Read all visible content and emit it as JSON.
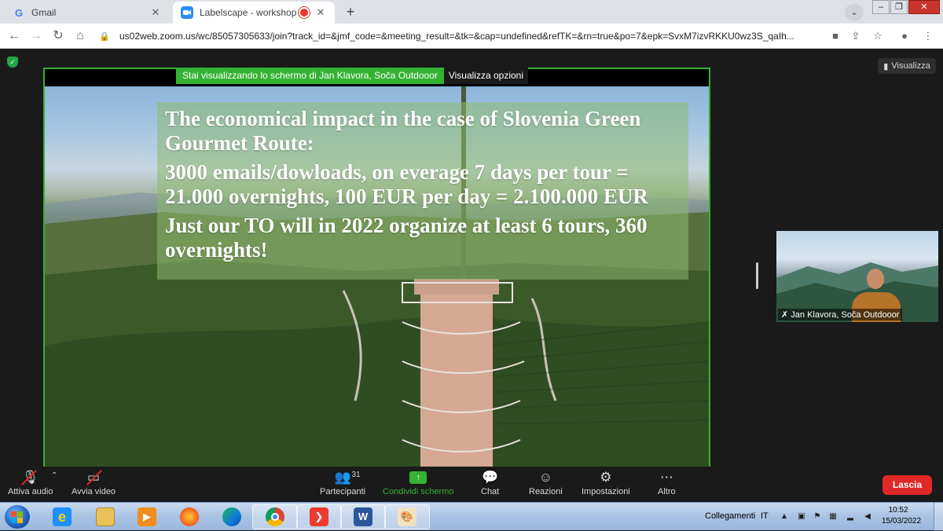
{
  "browser": {
    "tabs": [
      {
        "label": "Gmail",
        "icon": "gmail-icon"
      },
      {
        "label": "Labelscape - workshop",
        "icon": "zoom-icon"
      }
    ],
    "url": "us02web.zoom.us/wc/85057305633/join?track_id=&jmf_code=&meeting_result=&tk=&cap=undefined&refTK=&rn=true&po=7&epk=SvxM7izvRKKU0wz3S_qaIh...",
    "colors": {
      "tabbar": "#dee1e6",
      "active_tab": "#ffffff"
    }
  },
  "meeting": {
    "share_banner": "Stai visualizzando lo schermo di Jan Klavora, Soča Outdooor",
    "view_options": "Visualizza opzioni",
    "view_button": "Visualizza",
    "slide": {
      "paragraphs": [
        "The economical impact in the case of Slovenia Green Gourmet Route:",
        "3000 emails/dowloads, on everage 7 days per tour = 21.000 overnights, 100 EUR per day = 2.100.000 EUR",
        "Just our TO will in 2022 organize at least 6 tours, 360 overnights!"
      ]
    },
    "participant_tile": {
      "name": "Jan Klavora, Soča Outdooor"
    },
    "accent_color": "#34b233"
  },
  "toolbar": {
    "audio": "Attiva audio",
    "video": "Avvia video",
    "participants": "Partecipanti",
    "participants_count": "31",
    "share": "Condividi schermo",
    "chat": "Chat",
    "reactions": "Reazioni",
    "settings": "Impostazioni",
    "more": "Altro",
    "leave": "Lascia",
    "leave_color": "#e02828"
  },
  "taskbar": {
    "apps": [
      "internet-explorer-icon",
      "file-explorer-icon",
      "media-player-icon",
      "firefox-icon",
      "edge-icon",
      "chrome-icon",
      "anydesk-icon",
      "word-icon",
      "paint-icon"
    ],
    "tray_label": "Collegamenti",
    "language": "IT",
    "time": "10:52",
    "date": "15/03/2022"
  }
}
